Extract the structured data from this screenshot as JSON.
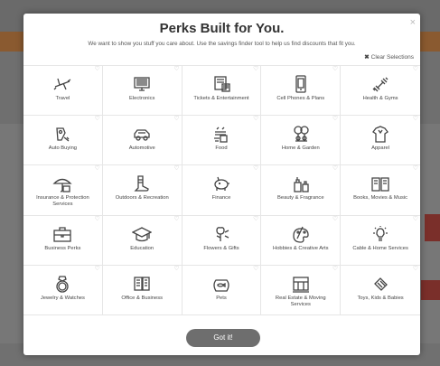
{
  "modal": {
    "title": "Perks Built for You.",
    "subtitle": "We want to show you stuff you care about. Use the savings finder tool to help us find discounts that fit you.",
    "clear_label": "Clear Selections",
    "close_glyph": "×",
    "button_label": "Got it!"
  },
  "categories": [
    {
      "label": "Travel",
      "icon": "airplane-icon"
    },
    {
      "label": "Electronics",
      "icon": "computer-icon"
    },
    {
      "label": "Tickets & Entertainment",
      "icon": "ticket-icon"
    },
    {
      "label": "Cell Phones & Plans",
      "icon": "phone-icon"
    },
    {
      "label": "Health & Gyms",
      "icon": "dumbbell-icon"
    },
    {
      "label": "Auto Buying",
      "icon": "car-keys-icon"
    },
    {
      "label": "Automotive",
      "icon": "car-icon"
    },
    {
      "label": "Food",
      "icon": "food-icon"
    },
    {
      "label": "Home & Garden",
      "icon": "garden-icon"
    },
    {
      "label": "Apparel",
      "icon": "shirt-icon"
    },
    {
      "label": "Insurance & Protection Services",
      "icon": "umbrella-icon"
    },
    {
      "label": "Outdoors & Recreation",
      "icon": "boot-icon"
    },
    {
      "label": "Finance",
      "icon": "piggy-bank-icon"
    },
    {
      "label": "Beauty & Fragrance",
      "icon": "perfume-icon"
    },
    {
      "label": "Books, Movies & Music",
      "icon": "book-icon"
    },
    {
      "label": "Business Perks",
      "icon": "briefcase-icon"
    },
    {
      "label": "Education",
      "icon": "graduation-cap-icon"
    },
    {
      "label": "Flowers & Gifts",
      "icon": "flower-icon"
    },
    {
      "label": "Hobbies & Creative Arts",
      "icon": "palette-icon"
    },
    {
      "label": "Cable & Home Services",
      "icon": "lightbulb-icon"
    },
    {
      "label": "Jewelry & Watches",
      "icon": "ring-icon"
    },
    {
      "label": "Office & Business",
      "icon": "office-icon"
    },
    {
      "label": "Pets",
      "icon": "fishbowl-icon"
    },
    {
      "label": "Real Estate & Moving Services",
      "icon": "house-icon"
    },
    {
      "label": "Toys, Kids & Babies",
      "icon": "toy-icon"
    }
  ]
}
